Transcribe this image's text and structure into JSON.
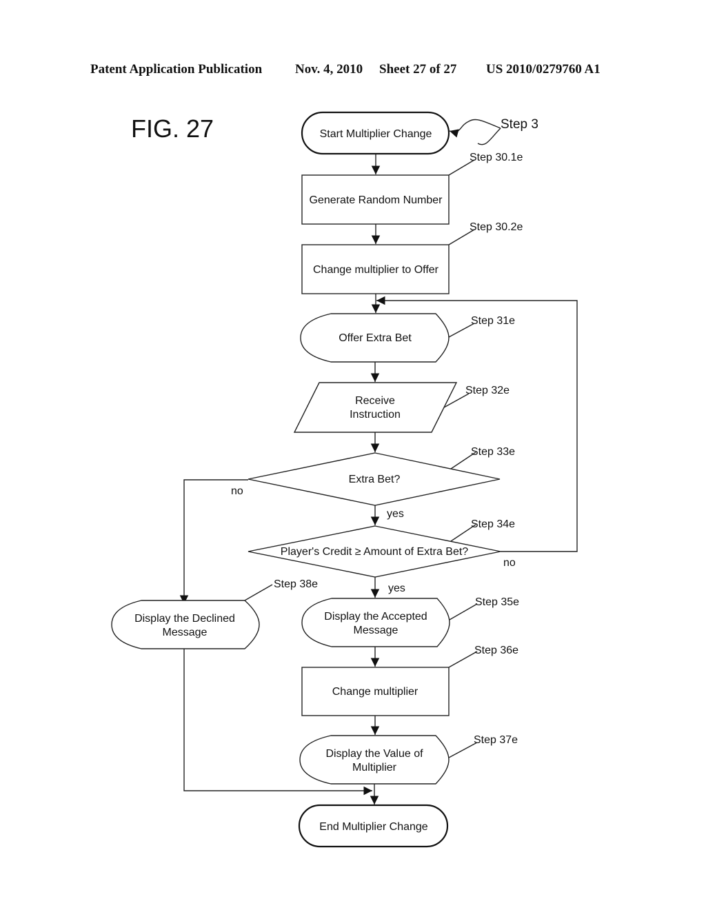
{
  "header": {
    "publication": "Patent Application Publication",
    "date": "Nov. 4, 2010",
    "sheet": "Sheet 27 of 27",
    "number": "US 2010/0279760 A1"
  },
  "figure_label": "FIG. 27",
  "nodes": {
    "start": {
      "label": "Start Multiplier Change",
      "step": "Step 3",
      "shape": "terminal"
    },
    "s30_1": {
      "label": "Generate Random Number",
      "step": "Step 30.1e",
      "shape": "process"
    },
    "s30_2": {
      "label": "Change multiplier to Offer",
      "step": "Step 30.2e",
      "shape": "process"
    },
    "s31": {
      "label": "Offer Extra Bet",
      "step": "Step 31e",
      "shape": "display"
    },
    "s32": {
      "line1": "Receive",
      "line2": "Instruction",
      "step": "Step 32e",
      "shape": "input"
    },
    "s33": {
      "label": "Extra Bet?",
      "step": "Step 33e",
      "shape": "decision"
    },
    "s34": {
      "label": "Player's Credit ≥ Amount of Extra Bet?",
      "step": "Step 34e",
      "shape": "decision"
    },
    "s35": {
      "line1": "Display the Accepted",
      "line2": "Message",
      "step": "Step 35e",
      "shape": "display"
    },
    "s36": {
      "label": "Change multiplier",
      "step": "Step 36e",
      "shape": "process"
    },
    "s37": {
      "line1": "Display the Value of",
      "line2": "Multiplier",
      "step": "Step 37e",
      "shape": "display"
    },
    "s38": {
      "line1": "Display the Declined",
      "line2": "Message",
      "step": "Step 38e",
      "shape": "display"
    },
    "end": {
      "label": "End Multiplier Change",
      "shape": "terminal"
    }
  },
  "edges": {
    "s33_no": "no",
    "s33_yes": "yes",
    "s34_no": "no",
    "s34_yes": "yes"
  }
}
